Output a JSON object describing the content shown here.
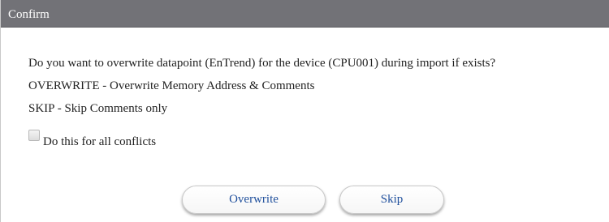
{
  "dialog": {
    "title": "Confirm",
    "message_lines": [
      "Do you want to overwrite datapoint (EnTrend) for the device (CPU001) during import if exists?",
      "OVERWRITE - Overwrite Memory Address & Comments",
      "SKIP - Skip Comments only"
    ],
    "checkbox": {
      "label": "Do this for all conflicts",
      "checked": false
    },
    "buttons": {
      "overwrite_label": "Overwrite",
      "skip_label": "Skip"
    }
  },
  "colors": {
    "titlebar": "#727277",
    "button_text": "#1f4f9c"
  }
}
